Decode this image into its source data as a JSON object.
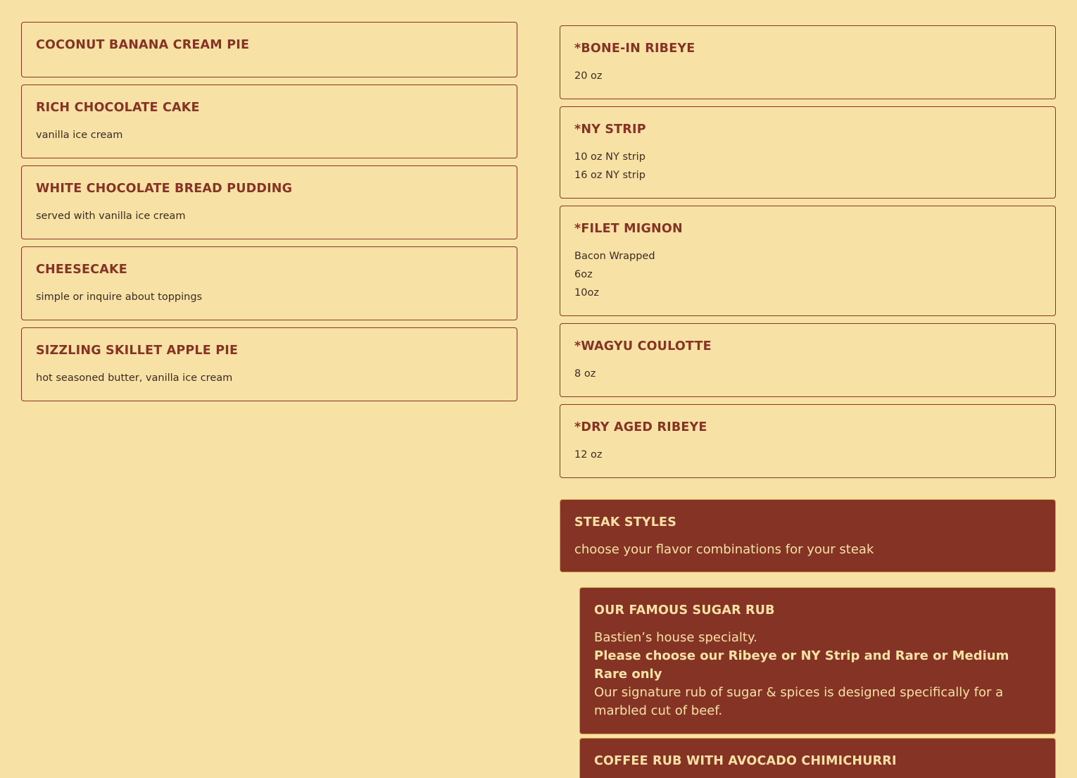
{
  "desserts": [
    {
      "title": "COCONUT BANANA CREAM PIE",
      "lines": []
    },
    {
      "title": "RICH CHOCOLATE CAKE",
      "lines": [
        "vanilla ice cream"
      ]
    },
    {
      "title": "WHITE CHOCOLATE BREAD PUDDING",
      "lines": [
        "served with vanilla ice cream"
      ]
    },
    {
      "title": "CHEESECAKE",
      "lines": [
        "simple or inquire about toppings"
      ]
    },
    {
      "title": "SIZZLING SKILLET APPLE PIE",
      "lines": [
        "hot seasoned butter, vanilla ice cream"
      ]
    }
  ],
  "steaks": [
    {
      "title": "*BONE-IN RIBEYE",
      "lines": [
        "20 oz"
      ]
    },
    {
      "title": "*NY STRIP",
      "lines": [
        "10 oz NY strip",
        "16 oz NY strip"
      ]
    },
    {
      "title": "*FILET MIGNON",
      "lines": [
        "Bacon Wrapped",
        "6oz",
        "10oz"
      ]
    },
    {
      "title": "*WAGYU COULOTTE",
      "lines": [
        "8 oz"
      ]
    },
    {
      "title": "*DRY AGED RIBEYE",
      "lines": [
        "12 oz"
      ]
    }
  ],
  "steak_styles": {
    "title": "STEAK STYLES",
    "subtitle": "choose your flavor combinations for your steak"
  },
  "sugar_rub": {
    "title": "OUR FAMOUS SUGAR RUB",
    "line1": "Bastien’s house specialty.",
    "line2": "Please choose our Ribeye or NY Strip and Rare or Medium Rare only",
    "line3": "Our signature rub of sugar & spices is designed specifically for a marbled cut of beef."
  },
  "coffee_rub": {
    "title": "COFFEE RUB WITH AVOCADO CHIMICHURRI"
  },
  "colors": {
    "background": "#f8e1a5",
    "accent": "#843324",
    "text": "#3b2b22"
  }
}
